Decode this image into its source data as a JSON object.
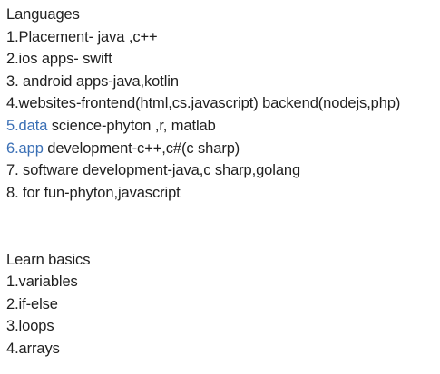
{
  "sections": [
    {
      "heading": "Languages",
      "items": [
        {
          "text": "1.Placement- java ,c++"
        },
        {
          "text": "2.ios apps- swift"
        },
        {
          "text": "3. android apps-java,kotlin"
        },
        {
          "text": "4.websites-frontend(html,cs.javascript) backend(nodejs,php)"
        },
        {
          "link": "5.data",
          "rest": " science-phyton ,r, matlab"
        },
        {
          "link": "6.app",
          "rest": " development-c++,c#(c sharp)"
        },
        {
          "text": "7. software development-java,c sharp,golang"
        },
        {
          "text": "8. for fun-phyton,javascript"
        }
      ]
    },
    {
      "heading": "Learn basics",
      "items": [
        {
          "text": "1.variables"
        },
        {
          "text": "2.if-else"
        },
        {
          "text": "3.loops"
        },
        {
          "text": "4.arrays"
        }
      ]
    }
  ],
  "colors": {
    "text": "#1f1f1f",
    "link": "#3a6fb5",
    "background": "#ffffff"
  }
}
